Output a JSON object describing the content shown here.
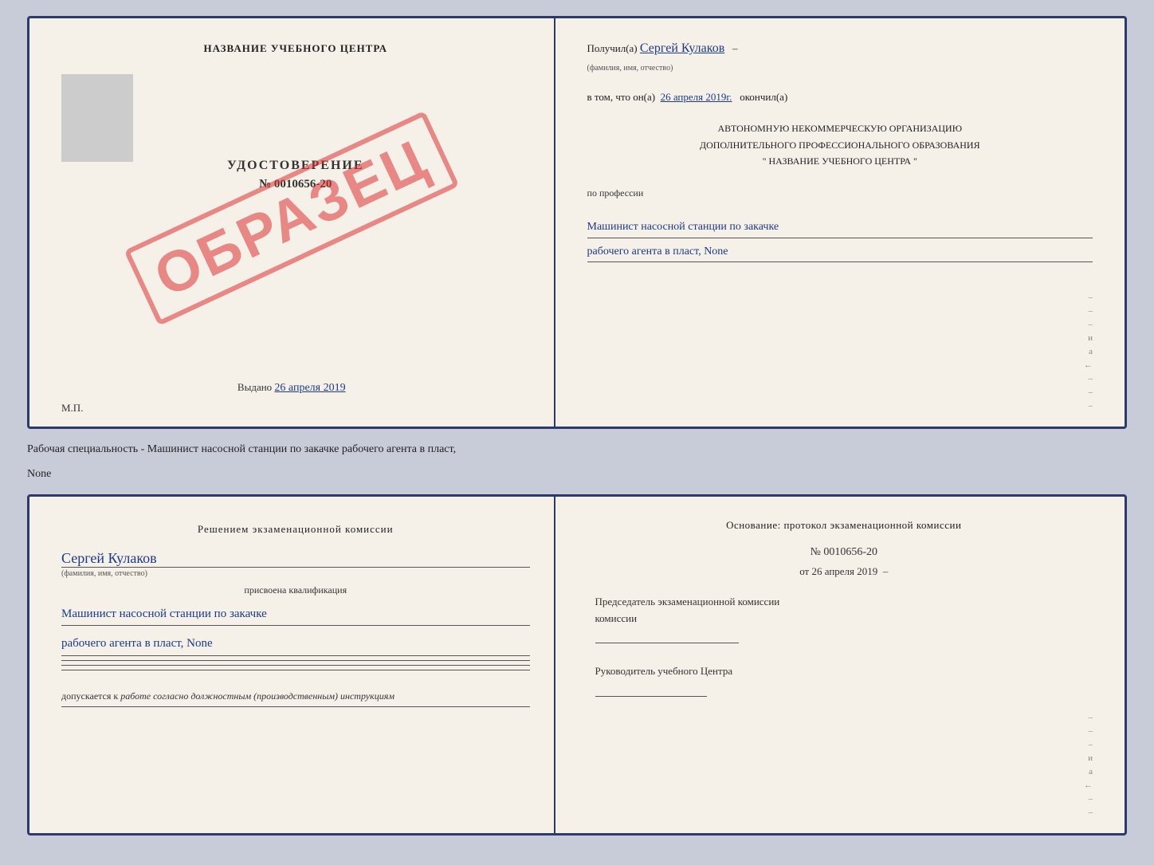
{
  "top_cert": {
    "left": {
      "title": "НАЗВАНИЕ УЧЕБНОГО ЦЕНТРА",
      "stamp": "ОБРАЗЕЦ",
      "udostoverenie_label": "УДОСТОВЕРЕНИЕ",
      "number": "№ 0010656-20",
      "vydano_label": "Выдано",
      "vydano_date": "26 апреля 2019",
      "mp_label": "М.П."
    },
    "right": {
      "poluchil_label": "Получил(a)",
      "poluchil_name": "Сергей Кулаков",
      "familiya_label": "(фамилия, имя, отчество)",
      "vtom_label": "в том, что он(а)",
      "vtom_date": "26 апреля 2019г.",
      "okonchil_label": "окончил(а)",
      "org_line1": "АВТОНОМНУЮ НЕКОММЕРЧЕСКУЮ ОРГАНИЗАЦИЮ",
      "org_line2": "ДОПОЛНИТЕЛЬНОГО ПРОФЕССИОНАЛЬНОГО ОБРАЗОВАНИЯ",
      "org_line3": "\" НАЗВАНИЕ УЧЕБНОГО ЦЕНТРА \"",
      "po_professii_label": "по профессии",
      "profession_line1": "Машинист насосной станции по закачке",
      "profession_line2": "рабочего агента в пласт, None"
    }
  },
  "specialty_text": "Рабочая специальность - Машинист насосной станции по закачке рабочего агента в пласт,",
  "specialty_text2": "None",
  "bottom_cert": {
    "left": {
      "resheniem_label": "Решением экзаменационной комиссии",
      "name_handwritten": "Сергей Кулаков",
      "familiya_label": "(фамилия, имя, отчество)",
      "prisvoena_label": "присвоена квалификация",
      "qual_line1": "Машинист насосной станции по закачке",
      "qual_line2": "рабочего агента в пласт, None",
      "dopuskaetsya_label": "допускается к",
      "dopuskaetsya_text": "работе согласно должностным (производственным) инструкциям"
    },
    "right": {
      "osnovanie_label": "Основание: протокол экзаменационной комиссии",
      "number_label": "№ 0010656-20",
      "ot_label": "от",
      "date": "26 апреля 2019",
      "predsedatel_label": "Председатель экзаменационной комиссии",
      "rukovoditel_label": "Руководитель учебного Центра"
    }
  },
  "right_side_marks": [
    "–",
    "–",
    "–",
    "и",
    "а",
    "←",
    "–",
    "–",
    "–"
  ]
}
